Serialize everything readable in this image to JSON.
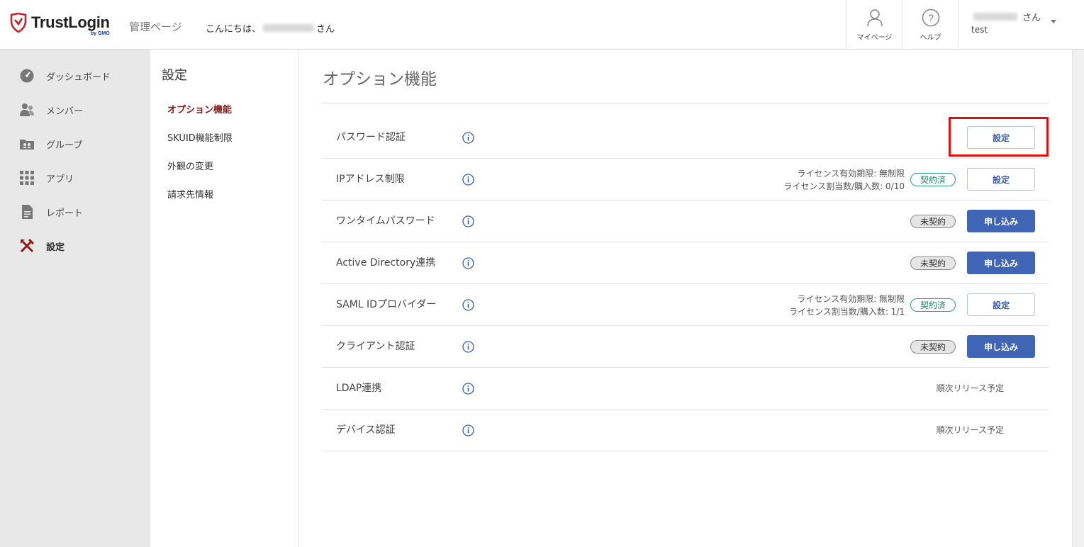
{
  "header": {
    "logo_text": "TrustLogin",
    "logo_sub": "by GMO",
    "admin_label": "管理ページ",
    "greeting_prefix": "こんにちは、",
    "greeting_suffix": "さん",
    "mypage_label": "マイページ",
    "help_label": "ヘルプ",
    "user_suffix": "さん",
    "user_org": "test"
  },
  "sidebar": {
    "items": [
      {
        "label": "ダッシュボード",
        "icon": "dashboard-icon"
      },
      {
        "label": "メンバー",
        "icon": "members-icon"
      },
      {
        "label": "グループ",
        "icon": "group-icon"
      },
      {
        "label": "アプリ",
        "icon": "apps-icon"
      },
      {
        "label": "レポート",
        "icon": "report-icon"
      },
      {
        "label": "設定",
        "icon": "settings-icon",
        "active": true
      }
    ]
  },
  "subnav": {
    "title": "設定",
    "items": [
      {
        "label": "オプション機能",
        "active": true
      },
      {
        "label": "SKUID機能制限"
      },
      {
        "label": "外観の変更"
      },
      {
        "label": "請求先情報"
      }
    ]
  },
  "main": {
    "title": "オプション機能",
    "rows": [
      {
        "name": "パスワード認証",
        "button": "設定"
      },
      {
        "name": "IPアドレス制限",
        "license_line1": "ライセンス有効期限: 無制限",
        "license_line2": "ライセンス割当数/購入数: 0/10",
        "badge": "契約済",
        "button": "設定"
      },
      {
        "name": "ワンタイムパスワード",
        "badge": "未契約",
        "button": "申し込み"
      },
      {
        "name": "Active Directory連携",
        "badge": "未契約",
        "button": "申し込み"
      },
      {
        "name": "SAML IDプロバイダー",
        "license_line1": "ライセンス有効期限: 無制限",
        "license_line2": "ライセンス割当数/購入数: 1/1",
        "badge": "契約済",
        "button": "設定"
      },
      {
        "name": "クライアント認証",
        "badge": "未契約",
        "button": "申し込み"
      },
      {
        "name": "LDAP連携",
        "status": "順次リリース予定"
      },
      {
        "name": "デバイス認証",
        "status": "順次リリース予定"
      }
    ]
  },
  "colors": {
    "accent_blue": "#3f65b4",
    "active_red": "#8b1a1a",
    "contracted_green": "#2aa37c",
    "highlight_red": "#e01010"
  }
}
